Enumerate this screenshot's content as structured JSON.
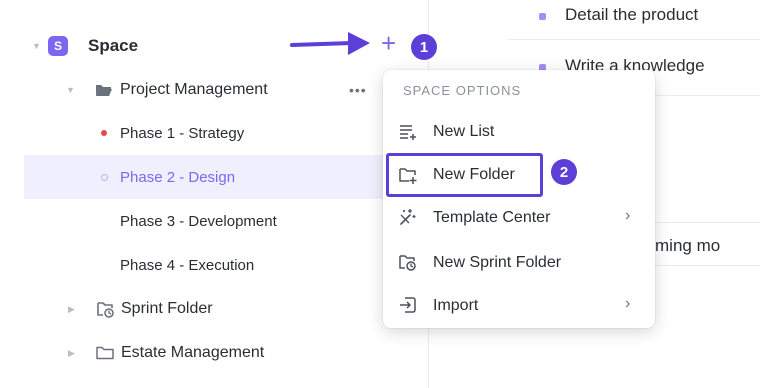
{
  "sidebar": {
    "space": {
      "badge": "S",
      "label": "Space"
    },
    "folder": {
      "label": "Project Management",
      "more": "•••"
    },
    "lists": [
      {
        "label": "Phase 1 - Strategy"
      },
      {
        "label": "Phase 2 - Design"
      },
      {
        "label": "Phase 3 - Development"
      },
      {
        "label": "Phase 4 - Execution"
      }
    ],
    "sprint_folder": {
      "label": "Sprint Folder"
    },
    "estate_folder": {
      "label": "Estate Management"
    }
  },
  "content": {
    "tasks": [
      {
        "text": "Detail the product"
      },
      {
        "text": "Write a knowledge"
      },
      {
        "text": "ming mo"
      }
    ]
  },
  "annotations": {
    "plus": "+",
    "step1": "1",
    "step2": "2"
  },
  "menu": {
    "header": "SPACE OPTIONS",
    "items": [
      {
        "label": "New List",
        "icon": "list-plus-icon",
        "chevron": ""
      },
      {
        "label": "New Folder",
        "icon": "folder-plus-icon",
        "chevron": ""
      },
      {
        "label": "Template Center",
        "icon": "magic-wand-icon",
        "chevron": "›"
      },
      {
        "label": "New Sprint Folder",
        "icon": "sprint-folder-icon",
        "chevron": ""
      },
      {
        "label": "Import",
        "icon": "import-icon",
        "chevron": "›"
      }
    ]
  },
  "colors": {
    "accent": "#7b68ee",
    "badge": "#5b3fd6",
    "selected_bg": "#f0effd",
    "status_red": "#e5484d"
  }
}
